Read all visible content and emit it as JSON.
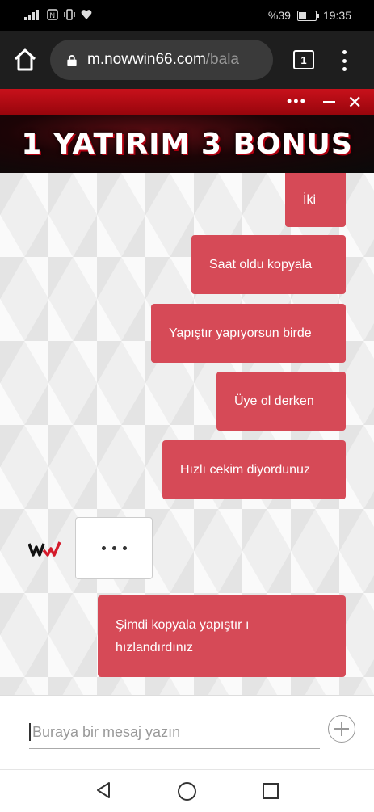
{
  "status": {
    "left_icons": "signal-icons",
    "battery_percent": "%39",
    "time": "19:35"
  },
  "browser": {
    "url_main": "m.nowwin66.com",
    "url_rest": "/bala",
    "tab_count": "1"
  },
  "banner": {
    "text": "1 YATIRIM 3 BONUS"
  },
  "messages": [
    {
      "text": "İki"
    },
    {
      "text": "Saat oldu kopyala"
    },
    {
      "text": "Yapıştır yapıyorsun birde"
    },
    {
      "text": "Üye ol derken"
    },
    {
      "text": "Hızlı cekim diyordunuz"
    },
    {
      "text": "Şimdi kopyala yapıştır ı hızlandırdınız"
    }
  ],
  "input": {
    "placeholder": "Buraya bir mesaj yazın"
  },
  "colors": {
    "bubble": "#d64a57",
    "header_red": "#c8111b"
  }
}
